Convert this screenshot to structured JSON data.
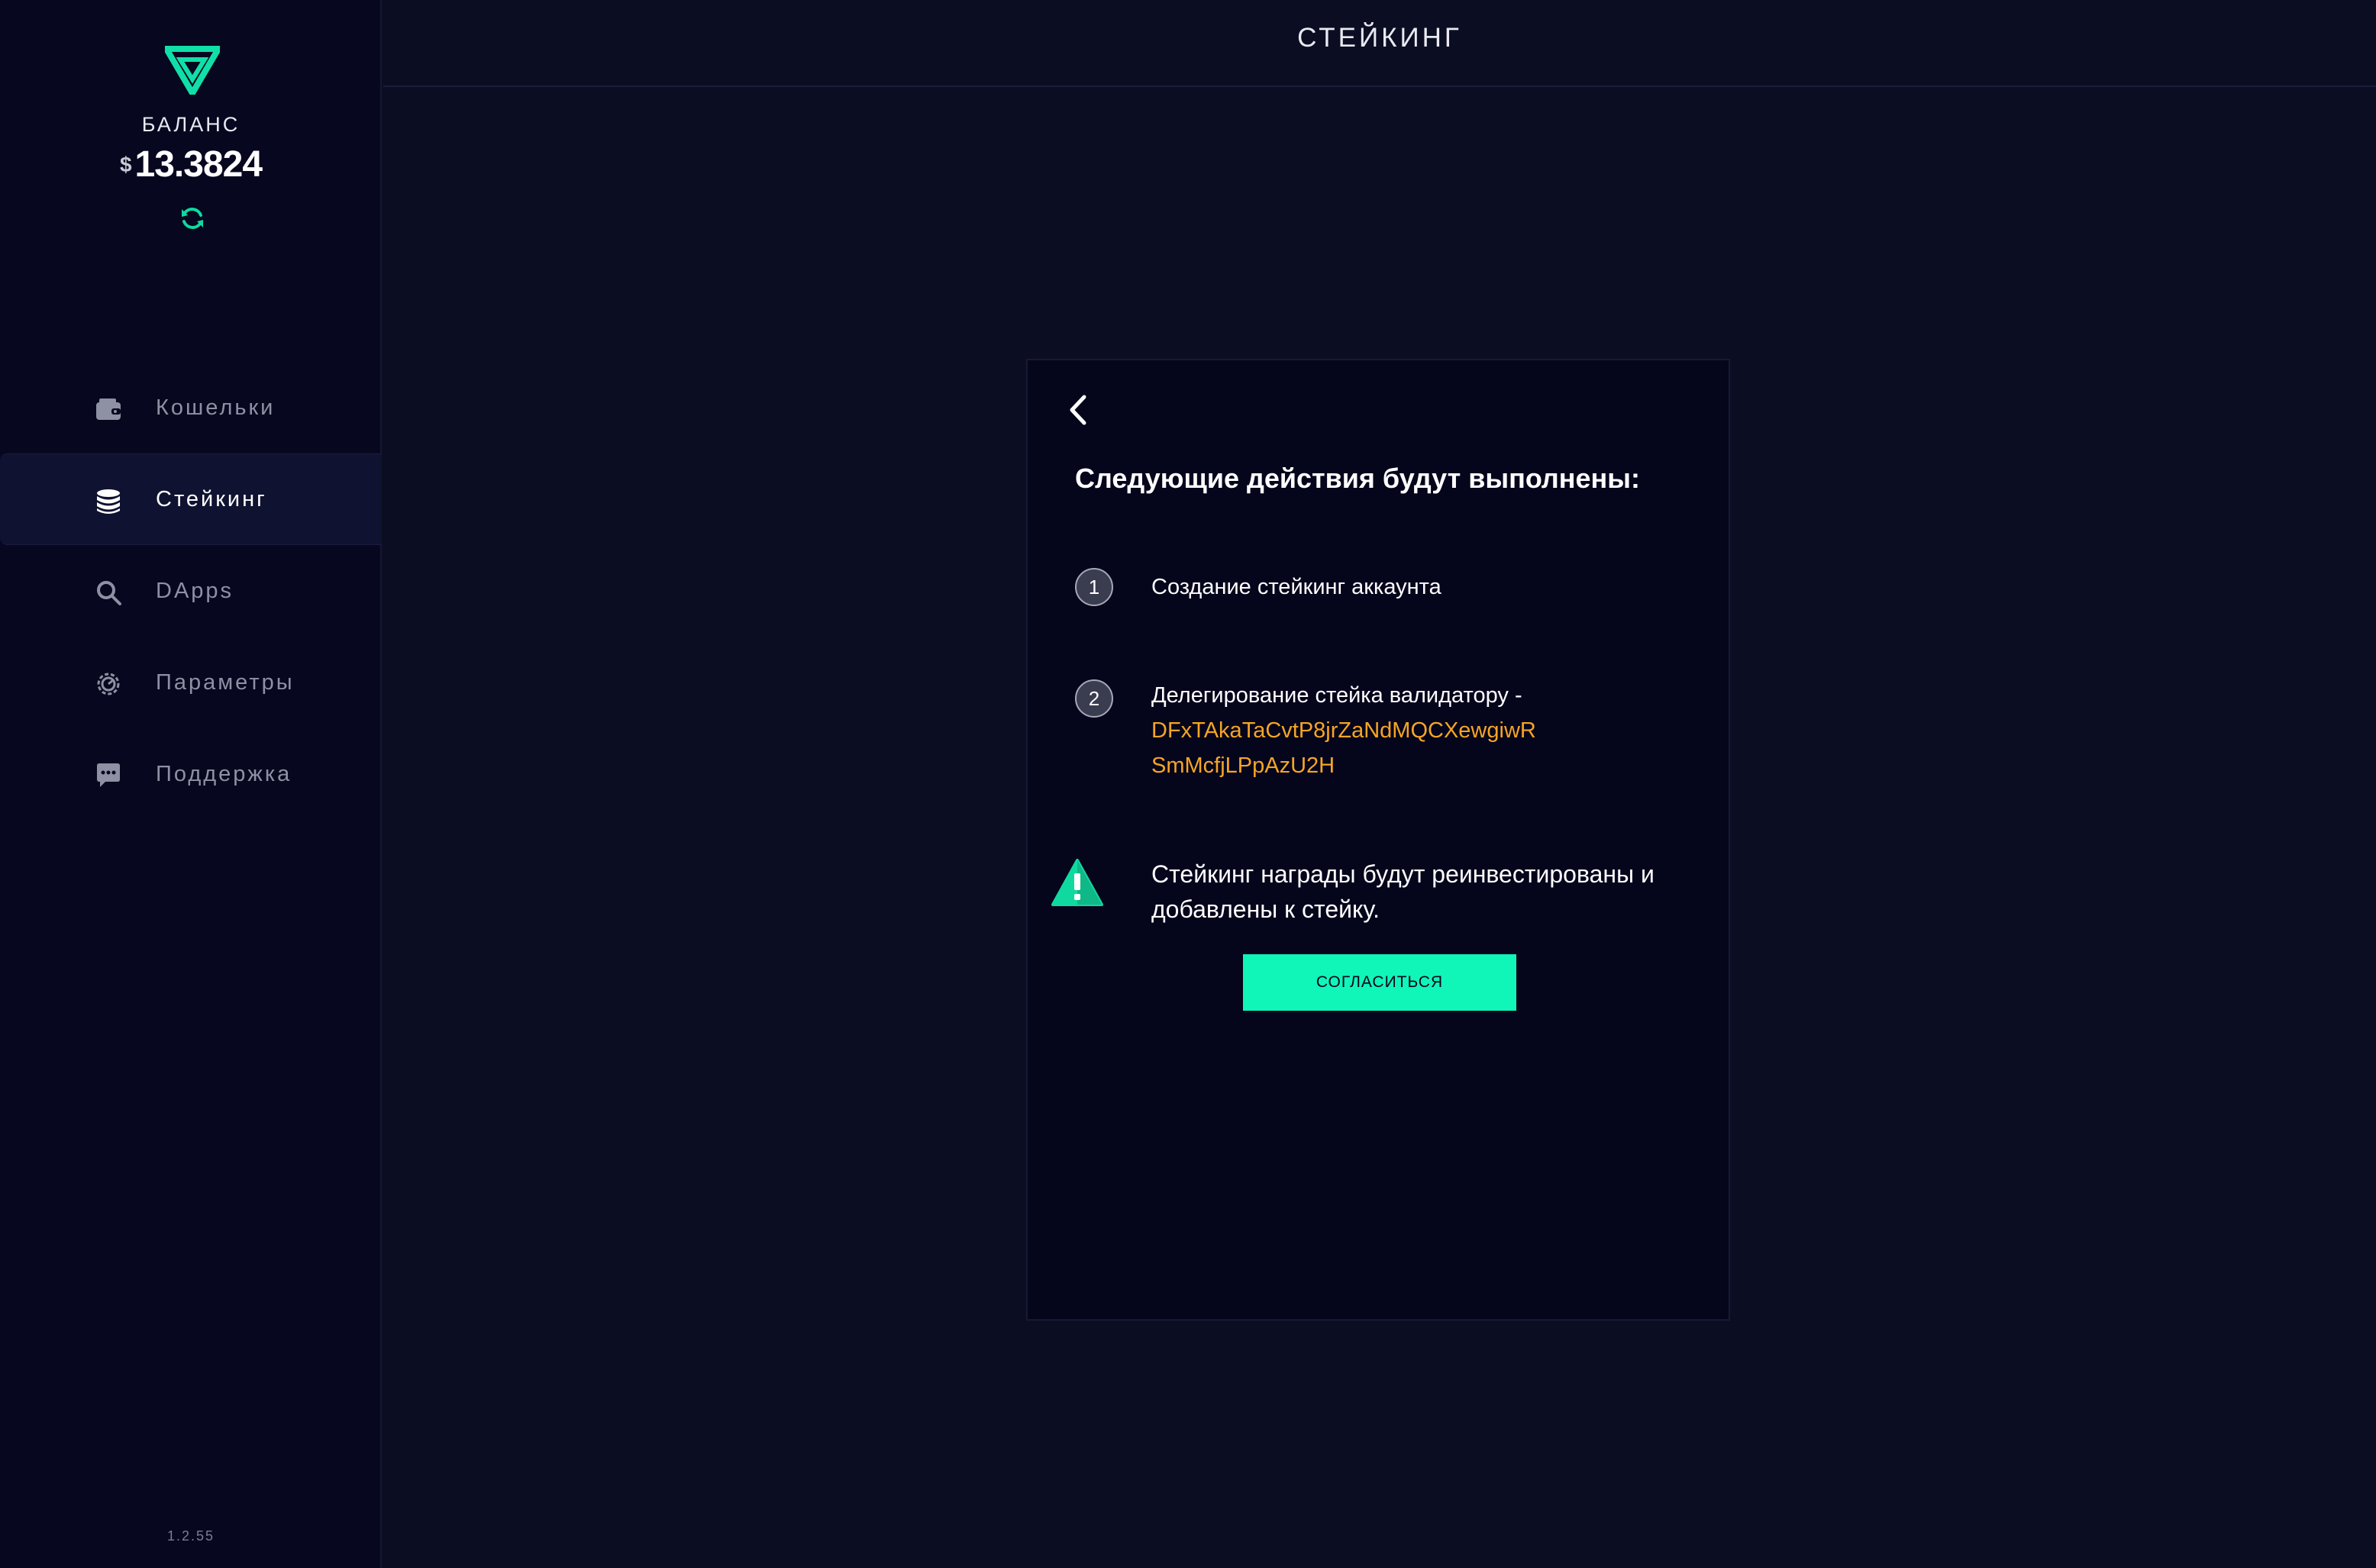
{
  "sidebar": {
    "balance_label": "БАЛАНС",
    "currency_symbol": "$",
    "balance_amount": "13.3824",
    "nav_items": [
      {
        "label": "Кошельки",
        "icon": "wallet-icon",
        "active": false
      },
      {
        "label": "Стейкинг",
        "icon": "coins-stack-icon",
        "active": true
      },
      {
        "label": "DApps",
        "icon": "search-icon",
        "active": false
      },
      {
        "label": "Параметры",
        "icon": "settings-icon",
        "active": false
      },
      {
        "label": "Поддержка",
        "icon": "chat-icon",
        "active": false
      }
    ],
    "version": "1.2.55"
  },
  "header": {
    "title": "СТЕЙКИНГ"
  },
  "card": {
    "heading": "Следующие действия будут выполнены:",
    "steps": [
      {
        "number": "1",
        "text": "Создание стейкинг аккаунта"
      },
      {
        "number": "2",
        "text": "Делегирование стейка валидатору -",
        "validator_line1": "DFxTAkaTaCvtP8jrZaNdMQCXewgiwR",
        "validator_line2": "SmMcfjLPpAzU2H"
      }
    ],
    "warning_line1": "Стейкинг награды будут реинвестированы и",
    "warning_line2": "добавлены к стейку.",
    "agree_label": "СОГЛАСИТЬСЯ"
  },
  "colors": {
    "accent": "#10f5b8",
    "background": "#0b0d22",
    "sidebar": "#070720",
    "card": "#05051c",
    "validator_address": "#f5a524"
  }
}
